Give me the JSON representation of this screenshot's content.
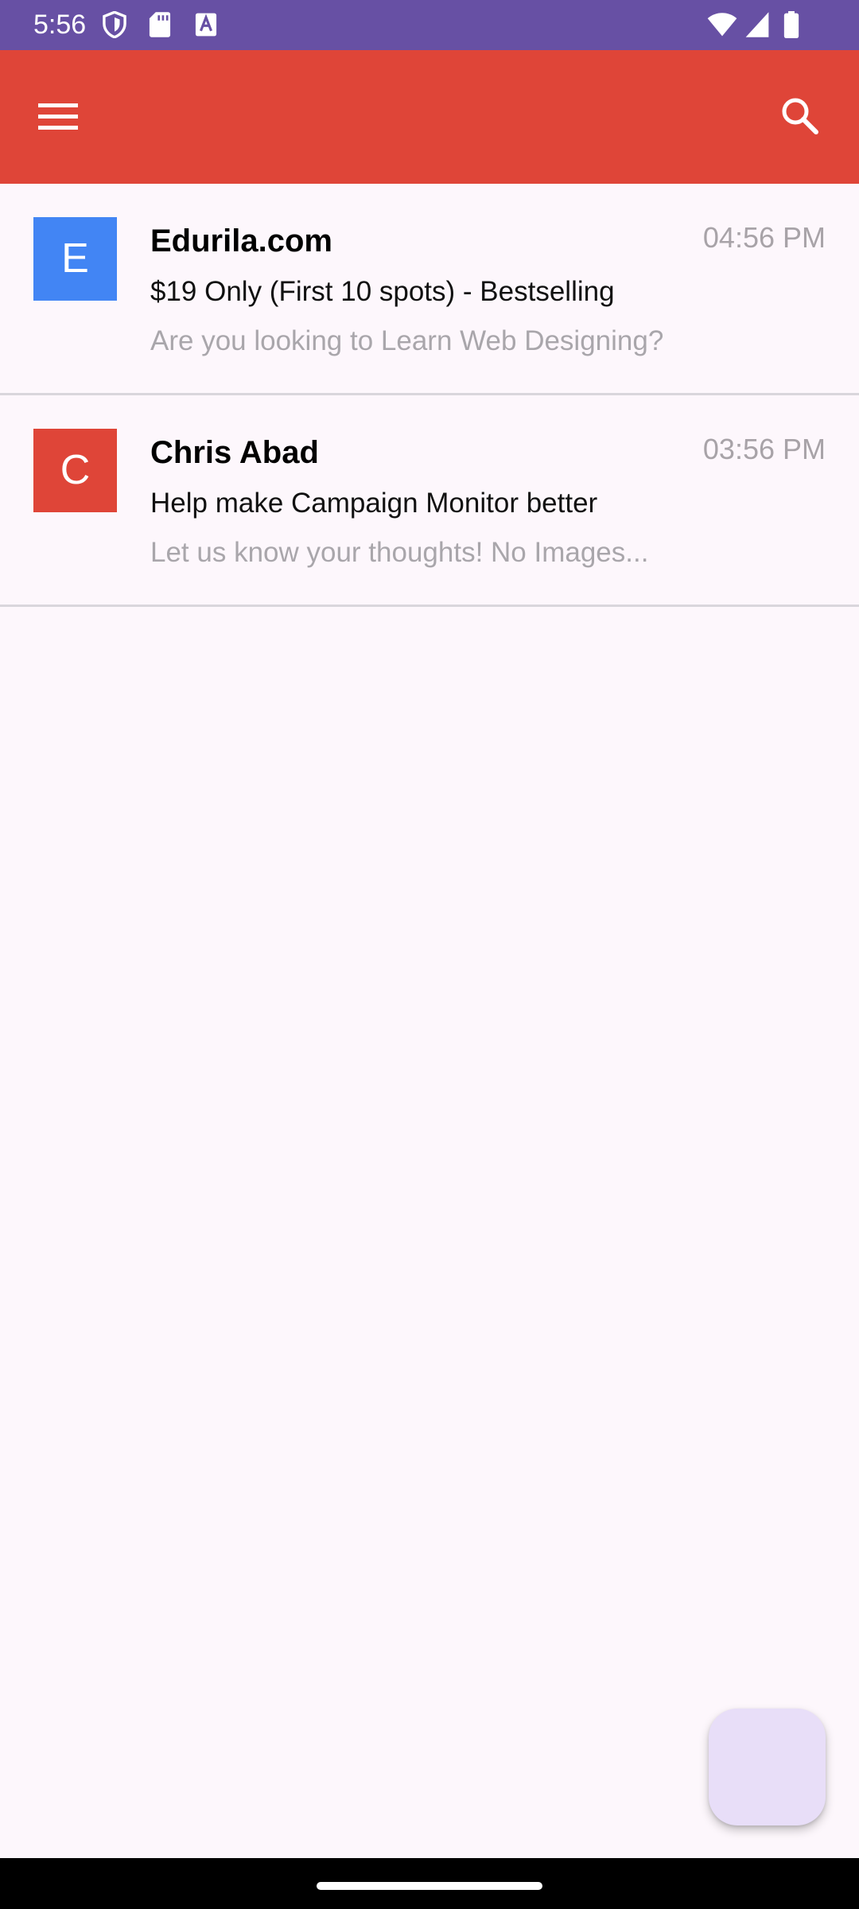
{
  "status_bar": {
    "time": "5:56",
    "background": "#6750A4",
    "left_icons": [
      "shield-icon",
      "sd-card-icon",
      "font-a-icon"
    ],
    "right_icons": [
      "wifi-icon",
      "signal-icon",
      "battery-icon"
    ]
  },
  "app_bar": {
    "background": "#DF4538",
    "menu_icon": "menu-icon",
    "search_icon": "search-icon"
  },
  "emails": [
    {
      "avatar_letter": "E",
      "avatar_color": "#4285F4",
      "sender": "Edurila.com",
      "time": "04:56 PM",
      "subject": "$19 Only (First 10 spots) - Bestselling",
      "preview": "Are you looking to Learn Web Designing?"
    },
    {
      "avatar_letter": "C",
      "avatar_color": "#DF4538",
      "sender": "Chris Abad",
      "time": "03:56 PM",
      "subject": "Help make Campaign Monitor better",
      "preview": "Let us know your thoughts! No Images..."
    }
  ],
  "fab": {
    "background": "#E8DEF8"
  }
}
